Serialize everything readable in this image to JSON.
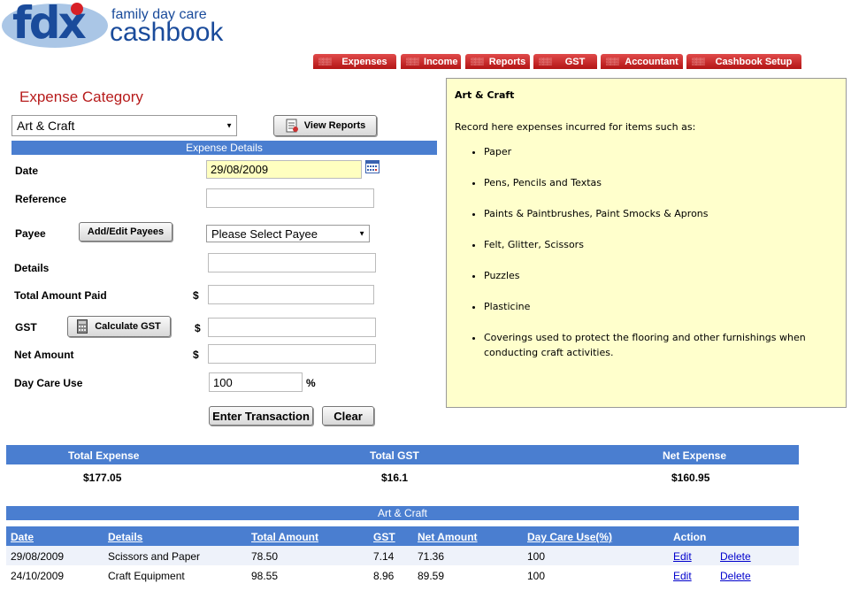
{
  "logo": {
    "mark": "fdx",
    "subtitle": "family day care",
    "title": "cashbook"
  },
  "nav": {
    "tabs": [
      "Expenses",
      "Income",
      "Reports",
      "GST",
      "Accountant",
      "Cashbook Setup"
    ]
  },
  "form": {
    "section_title": "Expense Category",
    "category_value": "Art & Craft",
    "view_reports": "View Reports",
    "details_header": "Expense Details",
    "date_label": "Date",
    "date_value": "29/08/2009",
    "reference_label": "Reference",
    "payee_label": "Payee",
    "add_edit_payees": "Add/Edit Payees",
    "payee_value": "Please Select Payee",
    "details_label": "Details",
    "total_amount_label": "Total Amount Paid",
    "gst_label": "GST",
    "calculate_gst": "Calculate GST",
    "net_amount_label": "Net Amount",
    "day_care_label": "Day Care Use",
    "day_care_value": "100",
    "currency": "$",
    "percent": "%",
    "enter_transaction": "Enter Transaction",
    "clear": "Clear"
  },
  "info": {
    "title": "Art & Craft",
    "intro": "Record here expenses incurred for items such as:",
    "items": [
      "Paper",
      "Pens, Pencils and Textas",
      "Paints & Paintbrushes, Paint Smocks & Aprons",
      "Felt, Glitter, Scissors",
      "Puzzles",
      "Plasticine",
      "Coverings used to protect the flooring and other furnishings when conducting craft activities."
    ]
  },
  "totals": {
    "total_expense_label": "Total Expense",
    "total_gst_label": "Total GST",
    "net_expense_label": "Net Expense",
    "total_expense": "$177.05",
    "total_gst": "$16.1",
    "net_expense": "$160.95"
  },
  "table": {
    "title": "Art & Craft",
    "headers": [
      "Date",
      "Details",
      "Total Amount",
      "GST",
      "Net Amount",
      "Day Care Use(%)",
      "Action"
    ],
    "rows": [
      [
        "29/08/2009",
        "Scissors and Paper",
        "78.50",
        "7.14",
        "71.36",
        "100"
      ],
      [
        "24/10/2009",
        "Craft Equipment",
        "98.55",
        "8.96",
        "89.59",
        "100"
      ]
    ],
    "edit": "Edit",
    "delete": "Delete"
  },
  "colors": {
    "accent_red": "#b71c1c",
    "header_blue": "#4a7ed0",
    "info_bg": "#ffffcc",
    "brand_blue": "#1a4b9b"
  }
}
